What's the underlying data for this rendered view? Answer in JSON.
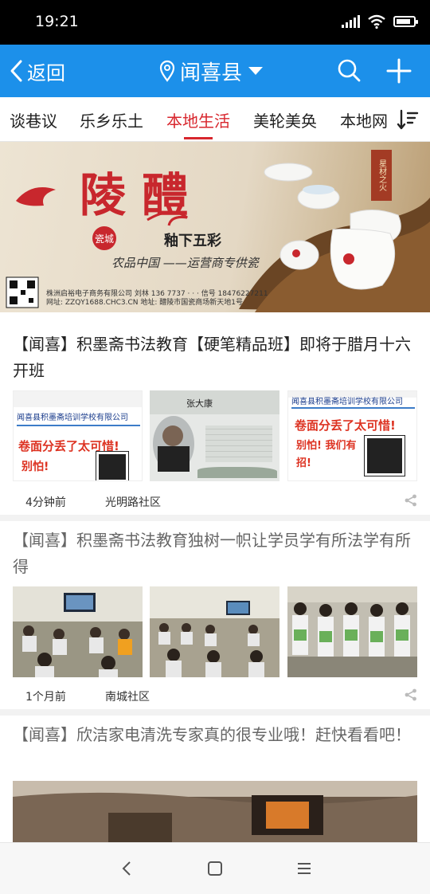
{
  "status_bar": {
    "time": "19:21",
    "battery_level": 0.85
  },
  "nav": {
    "back_label": "返回",
    "location": "闻喜县"
  },
  "tabs": [
    {
      "label": "谈巷议"
    },
    {
      "label": "乐乡乐土"
    },
    {
      "label": "本地生活",
      "active": true
    },
    {
      "label": "美轮美奂"
    },
    {
      "label": "本地网"
    }
  ],
  "banner": {
    "title": "陵 醴",
    "badge": "瓷城",
    "sub1": "釉下五彩",
    "sub2": "农品中国 ——运营商专供瓷",
    "tag": "星材之火",
    "footer_line1": "株洲启裕电子商务有限公司   刘林 136 7737 ·   ·   ·  信号 18476227211",
    "footer_line2": "网址: ZZQY1688.CHC3.CN                    地址: 醴陵市国瓷商场新天地1号"
  },
  "feed": [
    {
      "title": "【闻喜】积墨斋书法教育【硬笔精品班】即将于腊月十六开班",
      "time": "4分钟前",
      "location": "光明路社区",
      "thumbs": [
        {
          "label1": "闻喜县积墨斋培训学校有限公司",
          "label2": "卷面分丢了太可惜!",
          "label3": "别怕!"
        },
        {
          "label1": "张大康",
          "label2": "",
          "label3": ""
        },
        {
          "label1": "闻喜县积墨斋培训学校有限公司",
          "label2": "卷面分丢了太可惜!",
          "label3": "别怕! 我们有招!"
        }
      ]
    },
    {
      "title": "【闻喜】积墨斋书法教育独树一帜让学员学有所法学有所得",
      "time": "1个月前",
      "location": "南城社区"
    },
    {
      "title": "【闻喜】欣洁家电清洗专家真的很专业哦！赶快看看吧！"
    }
  ],
  "colors": {
    "accent": "#1c90ea",
    "active_tab": "#d8262d"
  }
}
